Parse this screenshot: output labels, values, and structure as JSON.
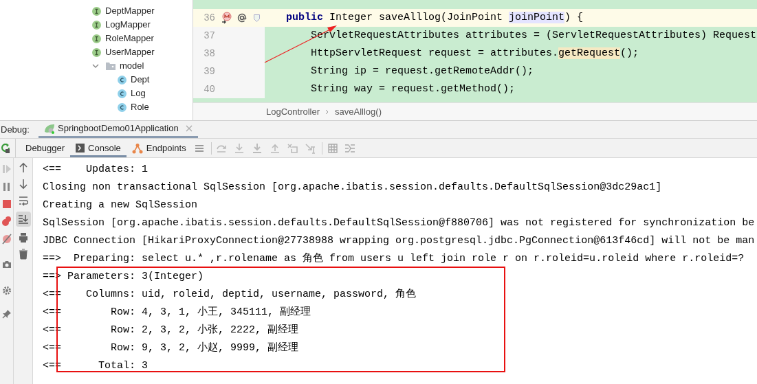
{
  "project_tree": {
    "items": [
      {
        "label": "DeptMapper",
        "kind": "interface"
      },
      {
        "label": "LogMapper",
        "kind": "interface"
      },
      {
        "label": "RoleMapper",
        "kind": "interface"
      },
      {
        "label": "UserMapper",
        "kind": "interface"
      },
      {
        "label": "model",
        "kind": "folder",
        "expanded": true,
        "children": [
          {
            "label": "Dept",
            "kind": "class"
          },
          {
            "label": "Log",
            "kind": "class"
          },
          {
            "label": "Role",
            "kind": "class"
          }
        ]
      }
    ]
  },
  "editor": {
    "lines": [
      {
        "number": "36",
        "current": true,
        "tokens": [
          {
            "text": "public",
            "kind": "keyword"
          },
          {
            "text": " Integer saveAlllog(JoinPoint ",
            "kind": "plain"
          },
          {
            "text": "joinPoint",
            "kind": "param"
          },
          {
            "text": ") {",
            "kind": "plain"
          }
        ]
      },
      {
        "number": "37",
        "current": false,
        "tokens": [
          {
            "text": "    ServletRequestAttributes attributes = (ServletRequestAttributes) Request",
            "kind": "plain"
          }
        ]
      },
      {
        "number": "38",
        "current": false,
        "tokens": [
          {
            "text": "    HttpServletRequest request = attributes.",
            "kind": "plain"
          },
          {
            "text": "getRequest",
            "kind": "usage"
          },
          {
            "text": "();",
            "kind": "plain"
          }
        ]
      },
      {
        "number": "39",
        "current": false,
        "tokens": [
          {
            "text": "    String ip = request.getRemoteAddr();",
            "kind": "plain"
          }
        ]
      },
      {
        "number": "40",
        "current": false,
        "tokens": [
          {
            "text": "    String way = request.getMethod();",
            "kind": "plain"
          }
        ]
      }
    ],
    "breadcrumb": [
      "LogController",
      "saveAlllog()"
    ]
  },
  "debug": {
    "title": "Debug:",
    "session_tab": {
      "label": "SpringbootDemo01Application",
      "selected": true
    },
    "tabs": [
      {
        "label": "Debugger",
        "selected": false
      },
      {
        "label": "Console",
        "selected": true
      },
      {
        "label": "Endpoints",
        "selected": false
      }
    ],
    "console": {
      "lines": [
        "<==    Updates: 1",
        "Closing non transactional SqlSession [org.apache.ibatis.session.defaults.DefaultSqlSession@3dc29ac1]",
        "Creating a new SqlSession",
        "SqlSession [org.apache.ibatis.session.defaults.DefaultSqlSession@f880706] was not registered for synchronization be",
        "JDBC Connection [HikariProxyConnection@27738988 wrapping org.postgresql.jdbc.PgConnection@613f46cd] will not be man",
        "==>  Preparing: select u.* ,r.rolename as 角色 from users u left join role r on r.roleid=u.roleid where r.roleid=?",
        "==> Parameters: 3(Integer)",
        "<==    Columns: uid, roleid, deptid, username, password, 角色",
        "<==        Row: 4, 3, 1, 小王, 345111, 副经理",
        "<==        Row: 2, 3, 2, 小张, 2222, 副经理",
        "<==        Row: 9, 3, 2, 小赵, 9999, 副经理",
        "<==      Total: 3"
      ]
    }
  }
}
